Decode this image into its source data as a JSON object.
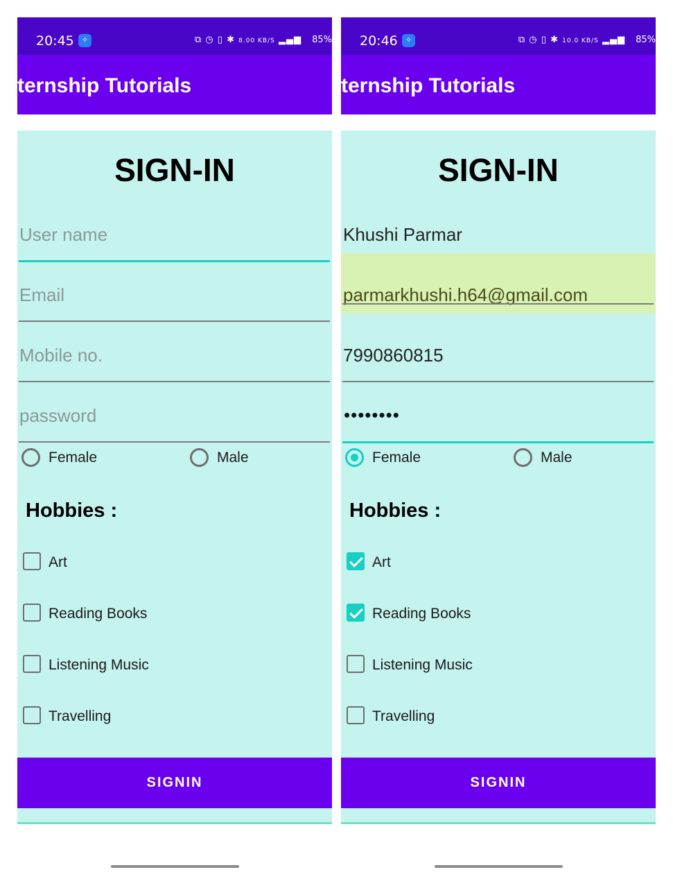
{
  "screens": [
    {
      "status": {
        "time": "20:45",
        "speed": "8.00 KB/S",
        "battery": "85%"
      },
      "app_title": "ternship Tutorials",
      "form": {
        "heading": "SIGN-IN",
        "username": {
          "placeholder": "User name",
          "value": ""
        },
        "email": {
          "placeholder": "Email",
          "value": ""
        },
        "mobile": {
          "placeholder": "Mobile no.",
          "value": ""
        },
        "password": {
          "placeholder": "password",
          "value": ""
        },
        "gender": {
          "female": {
            "label": "Female",
            "checked": false
          },
          "male": {
            "label": "Male",
            "checked": false
          }
        },
        "hobbies_label": "Hobbies :",
        "hobbies": [
          {
            "label": "Art",
            "checked": false
          },
          {
            "label": "Reading Books",
            "checked": false
          },
          {
            "label": "Listening Music",
            "checked": false
          },
          {
            "label": "Travelling",
            "checked": false
          }
        ],
        "submit_label": "SIGNIN"
      }
    },
    {
      "status": {
        "time": "20:46",
        "speed": "10.0 KB/S",
        "battery": "85%"
      },
      "app_title": "ternship Tutorials",
      "form": {
        "heading": "SIGN-IN",
        "username": {
          "placeholder": "User name",
          "value": "Khushi Parmar"
        },
        "email": {
          "placeholder": "Email",
          "value": "parmarkhushi.h64@gmail.com"
        },
        "mobile": {
          "placeholder": "Mobile no.",
          "value": "7990860815"
        },
        "password": {
          "placeholder": "password",
          "value": "••••••••"
        },
        "gender": {
          "female": {
            "label": "Female",
            "checked": true
          },
          "male": {
            "label": "Male",
            "checked": false
          }
        },
        "hobbies_label": "Hobbies :",
        "hobbies": [
          {
            "label": "Art",
            "checked": true
          },
          {
            "label": "Reading Books",
            "checked": true
          },
          {
            "label": "Listening Music",
            "checked": false
          },
          {
            "label": "Travelling",
            "checked": false
          }
        ],
        "submit_label": "SIGNIN"
      }
    }
  ],
  "colors": {
    "status_bar": "#4a06c8",
    "app_bar": "#6a00ee",
    "form_background": "#c5f3ee",
    "accent": "#17cfc2",
    "autofill": "#d8f2b4"
  }
}
